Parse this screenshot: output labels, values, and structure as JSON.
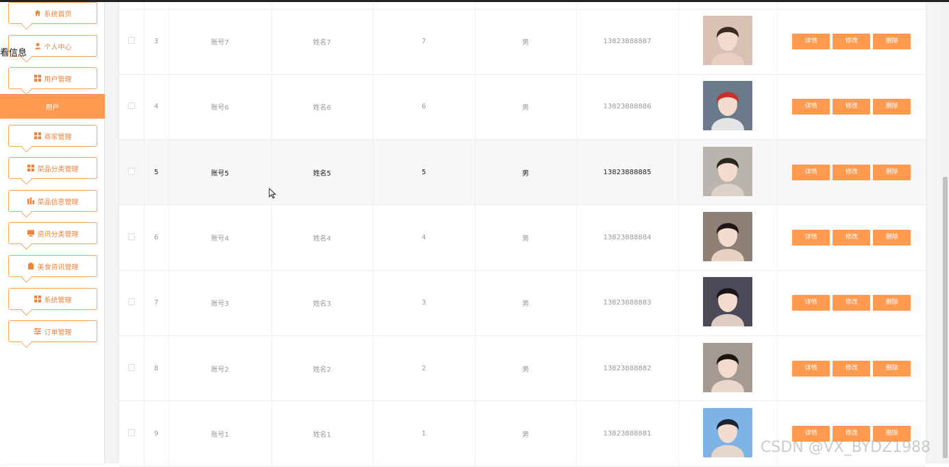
{
  "sidebar": {
    "floating_label": "看信息",
    "items": [
      {
        "label": "系统首页",
        "icon": "home-icon"
      },
      {
        "label": "个人中心",
        "icon": "user-icon"
      },
      {
        "label": "用户管理",
        "icon": "grid-icon"
      },
      {
        "label": "商家管理",
        "icon": "grid-icon"
      },
      {
        "label": "菜品分类管理",
        "icon": "grid-icon"
      },
      {
        "label": "菜品信息管理",
        "icon": "chart-icon"
      },
      {
        "label": "资讯分类管理",
        "icon": "monitor-icon"
      },
      {
        "label": "美食资讯管理",
        "icon": "clipboard-icon"
      },
      {
        "label": "系统管理",
        "icon": "grid-icon"
      },
      {
        "label": "订单管理",
        "icon": "sliders-icon"
      }
    ],
    "active_sub": "用户"
  },
  "table": {
    "rows": [
      {
        "index": "3",
        "account": "账号7",
        "name": "姓名7",
        "age": "7",
        "sex": "男",
        "phone": "13823888887",
        "photo": "avatar-photo"
      },
      {
        "index": "4",
        "account": "账号6",
        "name": "姓名6",
        "age": "6",
        "sex": "男",
        "phone": "13823888886",
        "photo": "avatar-photo"
      },
      {
        "index": "5",
        "account": "账号5",
        "name": "姓名5",
        "age": "5",
        "sex": "男",
        "phone": "13823888885",
        "photo": "avatar-photo"
      },
      {
        "index": "6",
        "account": "账号4",
        "name": "姓名4",
        "age": "4",
        "sex": "男",
        "phone": "13823888884",
        "photo": "avatar-photo"
      },
      {
        "index": "7",
        "account": "账号3",
        "name": "姓名3",
        "age": "3",
        "sex": "男",
        "phone": "13823888883",
        "photo": "avatar-photo"
      },
      {
        "index": "8",
        "account": "账号2",
        "name": "姓名2",
        "age": "2",
        "sex": "男",
        "phone": "13823888882",
        "photo": "avatar-photo"
      },
      {
        "index": "9",
        "account": "账号1",
        "name": "姓名1",
        "age": "1",
        "sex": "男",
        "phone": "13823888881",
        "photo": "avatar-photo"
      }
    ],
    "actions": {
      "detail": "详情",
      "edit": "修改",
      "delete": "删除"
    }
  },
  "watermark": "CSDN @VX_BYDZ1988",
  "colors": {
    "accent": "#ff9a50",
    "accent_text": "#f0833a"
  }
}
